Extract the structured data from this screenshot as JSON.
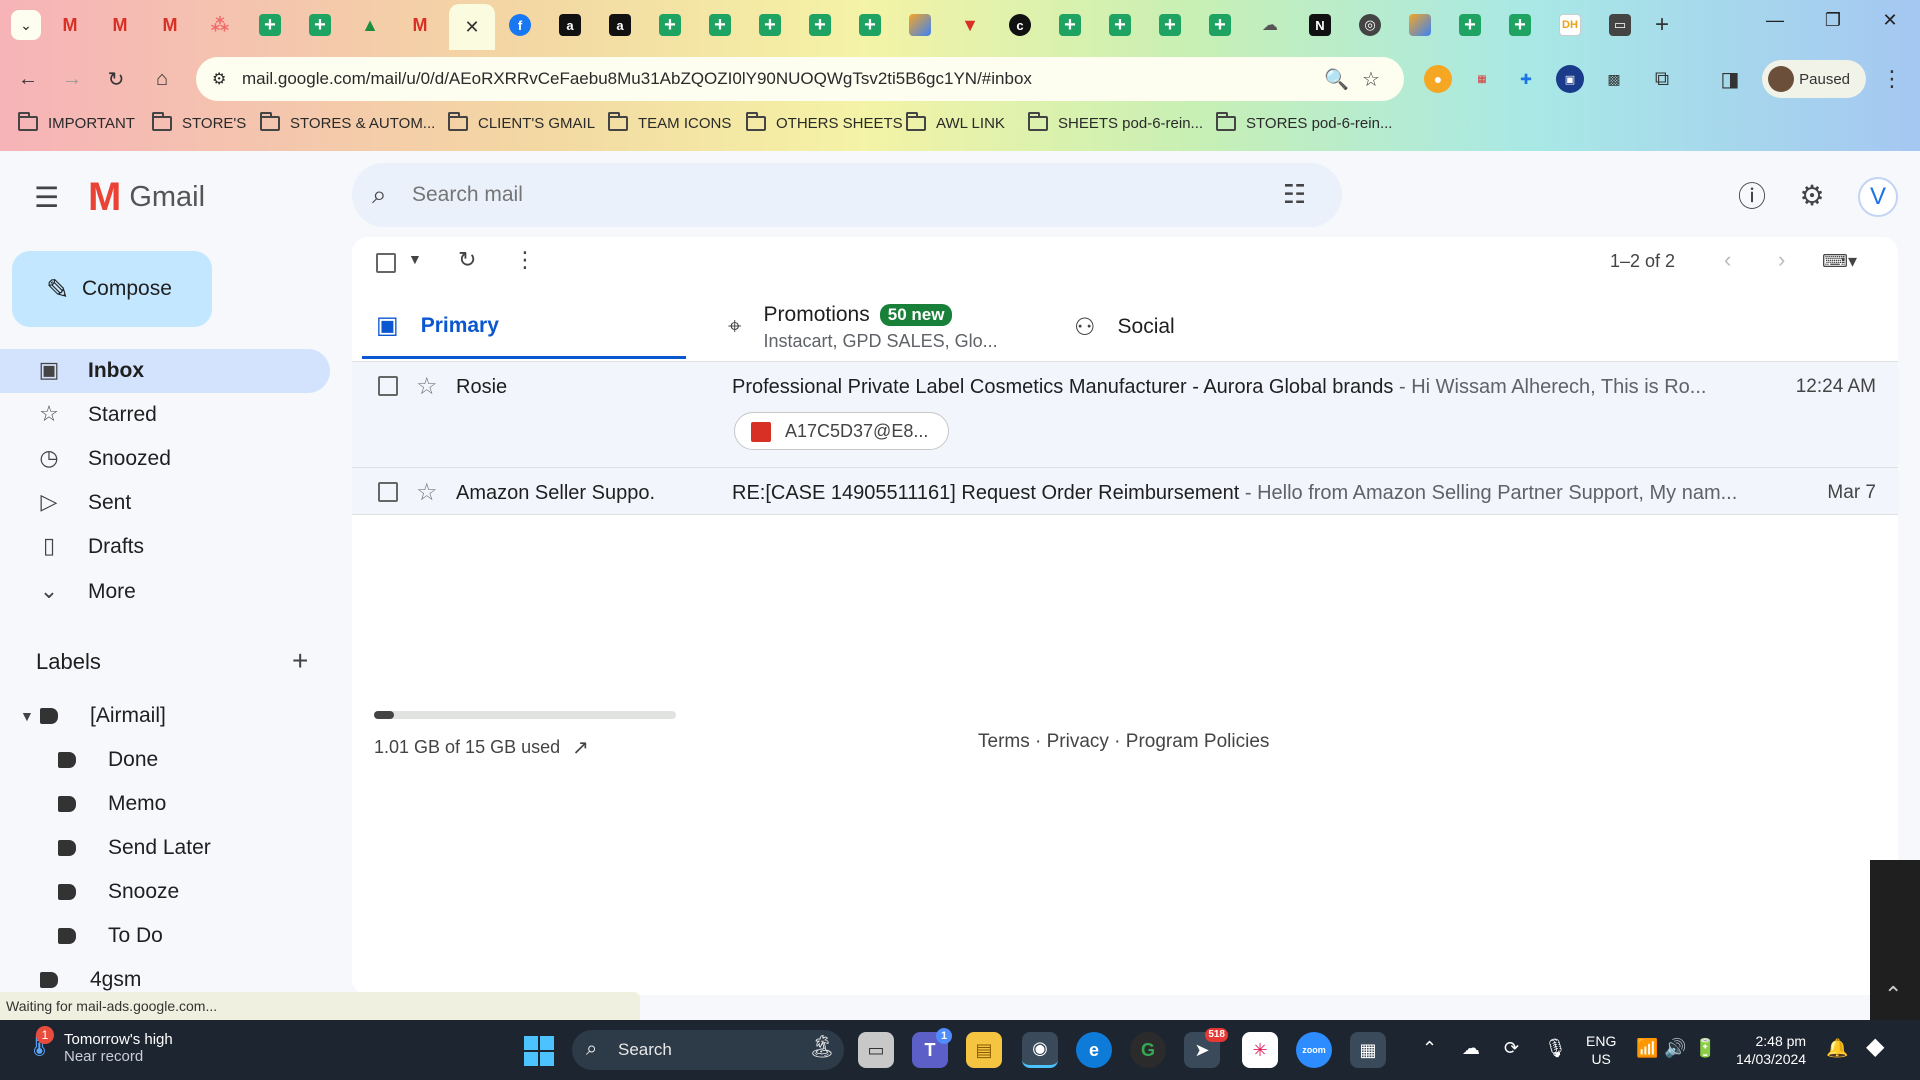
{
  "browser": {
    "tab_icons": [
      "gmail",
      "gmail",
      "gmail",
      "asana",
      "sheets",
      "sheets",
      "drive",
      "gmail",
      "active",
      "facebook",
      "amazon",
      "amazon",
      "sheets",
      "sheets",
      "sheets",
      "sheets",
      "sheets",
      "zapier",
      "flag",
      "c",
      "sheets",
      "sheets",
      "sheets",
      "cloud",
      "upwork",
      "circle",
      "zapier",
      "sheets",
      "sheets",
      "dh",
      "screen"
    ],
    "url": "mail.google.com/mail/u/0/d/AEoRXRRvCeFaebu8Mu31AbZQOZI0lY90NUOQWgTsv2ti5B6gc1YN/#inbox",
    "profile_status": "Paused",
    "bookmarks": [
      "IMPORTANT",
      "STORE'S",
      "STORES & AUTOM...",
      "CLIENT'S GMAIL",
      "TEAM ICONS",
      "OTHERS SHEETS",
      "AWL LINK",
      "SHEETS pod-6-rein...",
      "STORES pod-6-rein..."
    ],
    "theme_colors": [
      "#f6b3b8",
      "#f4f3a6",
      "#c8f0b4",
      "#a5c7f2"
    ]
  },
  "gmail": {
    "logo_text": "Gmail",
    "search_placeholder": "Search mail",
    "avatar_letter": "V",
    "compose_label": "Compose",
    "nav": [
      {
        "label": "Inbox",
        "icon": "inbox-icon",
        "active": true
      },
      {
        "label": "Starred",
        "icon": "star-icon"
      },
      {
        "label": "Snoozed",
        "icon": "clock-icon"
      },
      {
        "label": "Sent",
        "icon": "send-icon"
      },
      {
        "label": "Drafts",
        "icon": "draft-icon"
      },
      {
        "label": "More",
        "icon": "chevron-down-icon"
      }
    ],
    "labels_heading": "Labels",
    "labels": [
      {
        "label": "[Airmail]",
        "level": 0,
        "expanded": true
      },
      {
        "label": "Done",
        "level": 1
      },
      {
        "label": "Memo",
        "level": 1
      },
      {
        "label": "Send Later",
        "level": 1
      },
      {
        "label": "Snooze",
        "level": 1
      },
      {
        "label": "To Do",
        "level": 1
      },
      {
        "label": "4gsm",
        "level": 0
      }
    ],
    "pager": "1–2 of 2",
    "tabs": [
      {
        "label": "Primary",
        "icon": "inbox-icon",
        "active": true
      },
      {
        "label": "Promotions",
        "icon": "tag-icon",
        "badge": "50 new",
        "subtitle": "Instacart, GPD SALES, Glo..."
      },
      {
        "label": "Social",
        "icon": "people-icon"
      }
    ],
    "emails": [
      {
        "sender": "Rosie",
        "subject": "Professional Private Label Cosmetics Manufacturer - Aurora Global brands",
        "snippet": " - Hi Wissam Alherech,  This is Ro...",
        "date": "12:24 AM",
        "attachment": "A17C5D37@E8..."
      },
      {
        "sender": "Amazon Seller Suppo.",
        "subject": "RE:[CASE 14905511161] Request Order Reimbursement",
        "snippet": " - Hello from Amazon Selling Partner Support, My nam...",
        "date": "Mar 7"
      }
    ],
    "storage": {
      "text": "1.01 GB of 15 GB used",
      "used_fraction": 0.067
    },
    "footer": "Terms · Privacy · Program Policies",
    "status_text": "Waiting for mail-ads.google.com..."
  },
  "taskbar": {
    "weather_line1": "Tomorrow's high",
    "weather_line2": "Near record",
    "weather_badge": "1",
    "search_label": "Search",
    "teams_badge": "1",
    "telegram_badge": "518",
    "lang_line1": "ENG",
    "lang_line2": "US",
    "time": "2:48 pm",
    "date": "14/03/2024"
  }
}
